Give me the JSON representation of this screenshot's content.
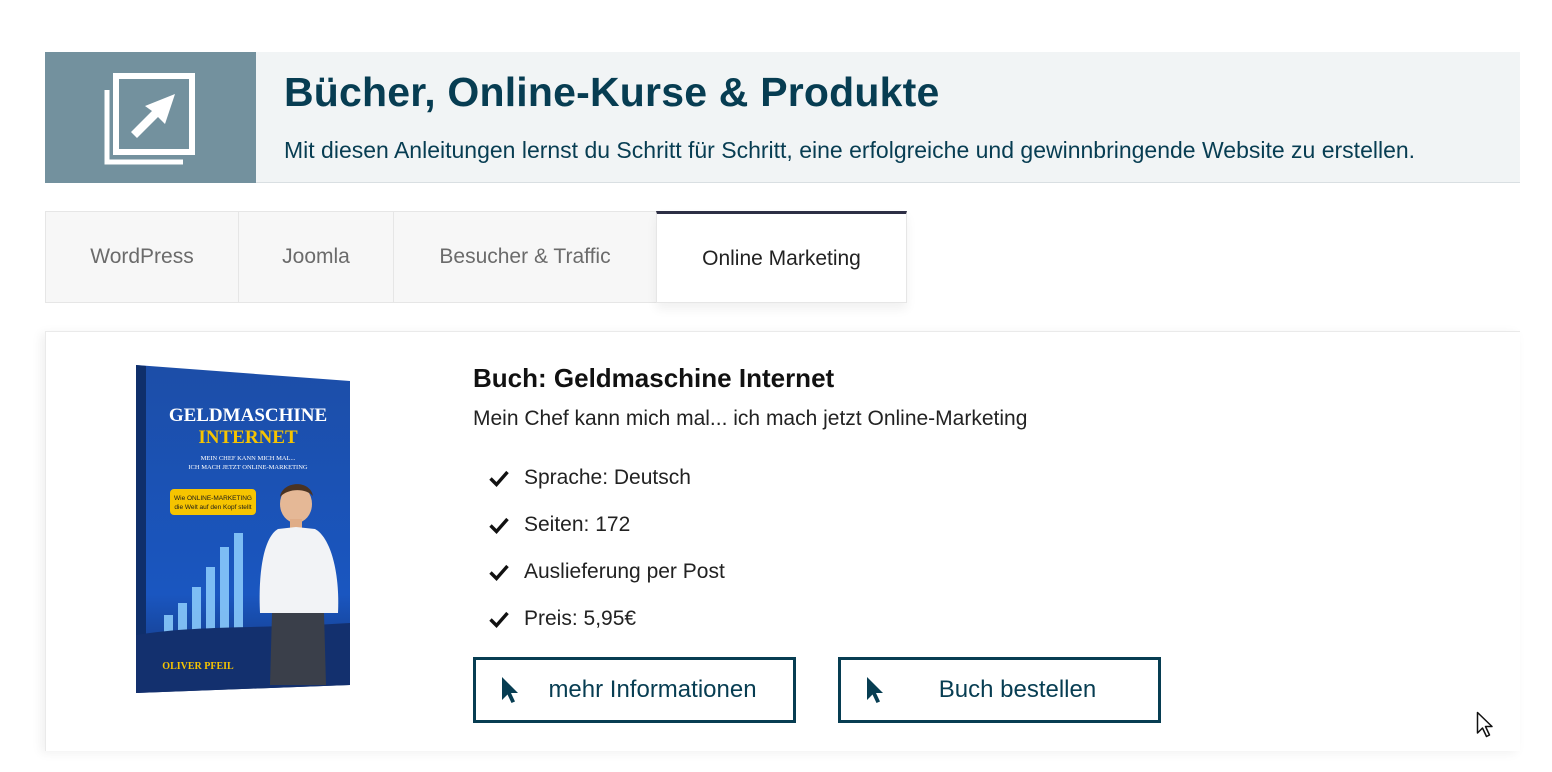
{
  "header": {
    "title": "Bücher, Online-Kurse & Produkte",
    "subtitle": "Mit diesen Anleitungen lernst du Schritt für Schritt, eine erfolgreiche und gewinnbringende Website zu erstellen.",
    "icon": "external-link-icon"
  },
  "tabs": [
    {
      "label": "WordPress",
      "active": false
    },
    {
      "label": "Joomla",
      "active": false
    },
    {
      "label": "Besucher & Traffic",
      "active": false
    },
    {
      "label": "Online Marketing",
      "active": true
    }
  ],
  "product": {
    "title": "Buch: Geldmaschine Internet",
    "subtitle": "Mein Chef kann mich mal... ich mach jetzt Online-Marketing",
    "features": [
      "Sprache: Deutsch",
      "Seiten: 172",
      "Auslieferung per Post",
      "Preis: 5,95€"
    ],
    "cover": {
      "title_line1": "GELDMASCHINE",
      "title_line2": "INTERNET",
      "tagline_line1": "MEIN CHEF KANN MICH MAL...",
      "tagline_line2": "ICH MACH JETZT ONLINE-MARKETING",
      "badge_line1": "Wie ONLINE-MARKETING",
      "badge_line2": "die Welt auf den Kopf stellt",
      "author": "OLIVER PFEIL"
    },
    "buttons": {
      "more_info": "mehr Informationen",
      "order": "Buch bestellen"
    }
  },
  "colors": {
    "primary": "#073d52",
    "icon_box": "#73919e",
    "header_bg": "#f1f4f5",
    "active_tab_border": "#2d2f45",
    "cover_blue": "#1d4fa8",
    "badge_yellow": "#f6c400"
  }
}
